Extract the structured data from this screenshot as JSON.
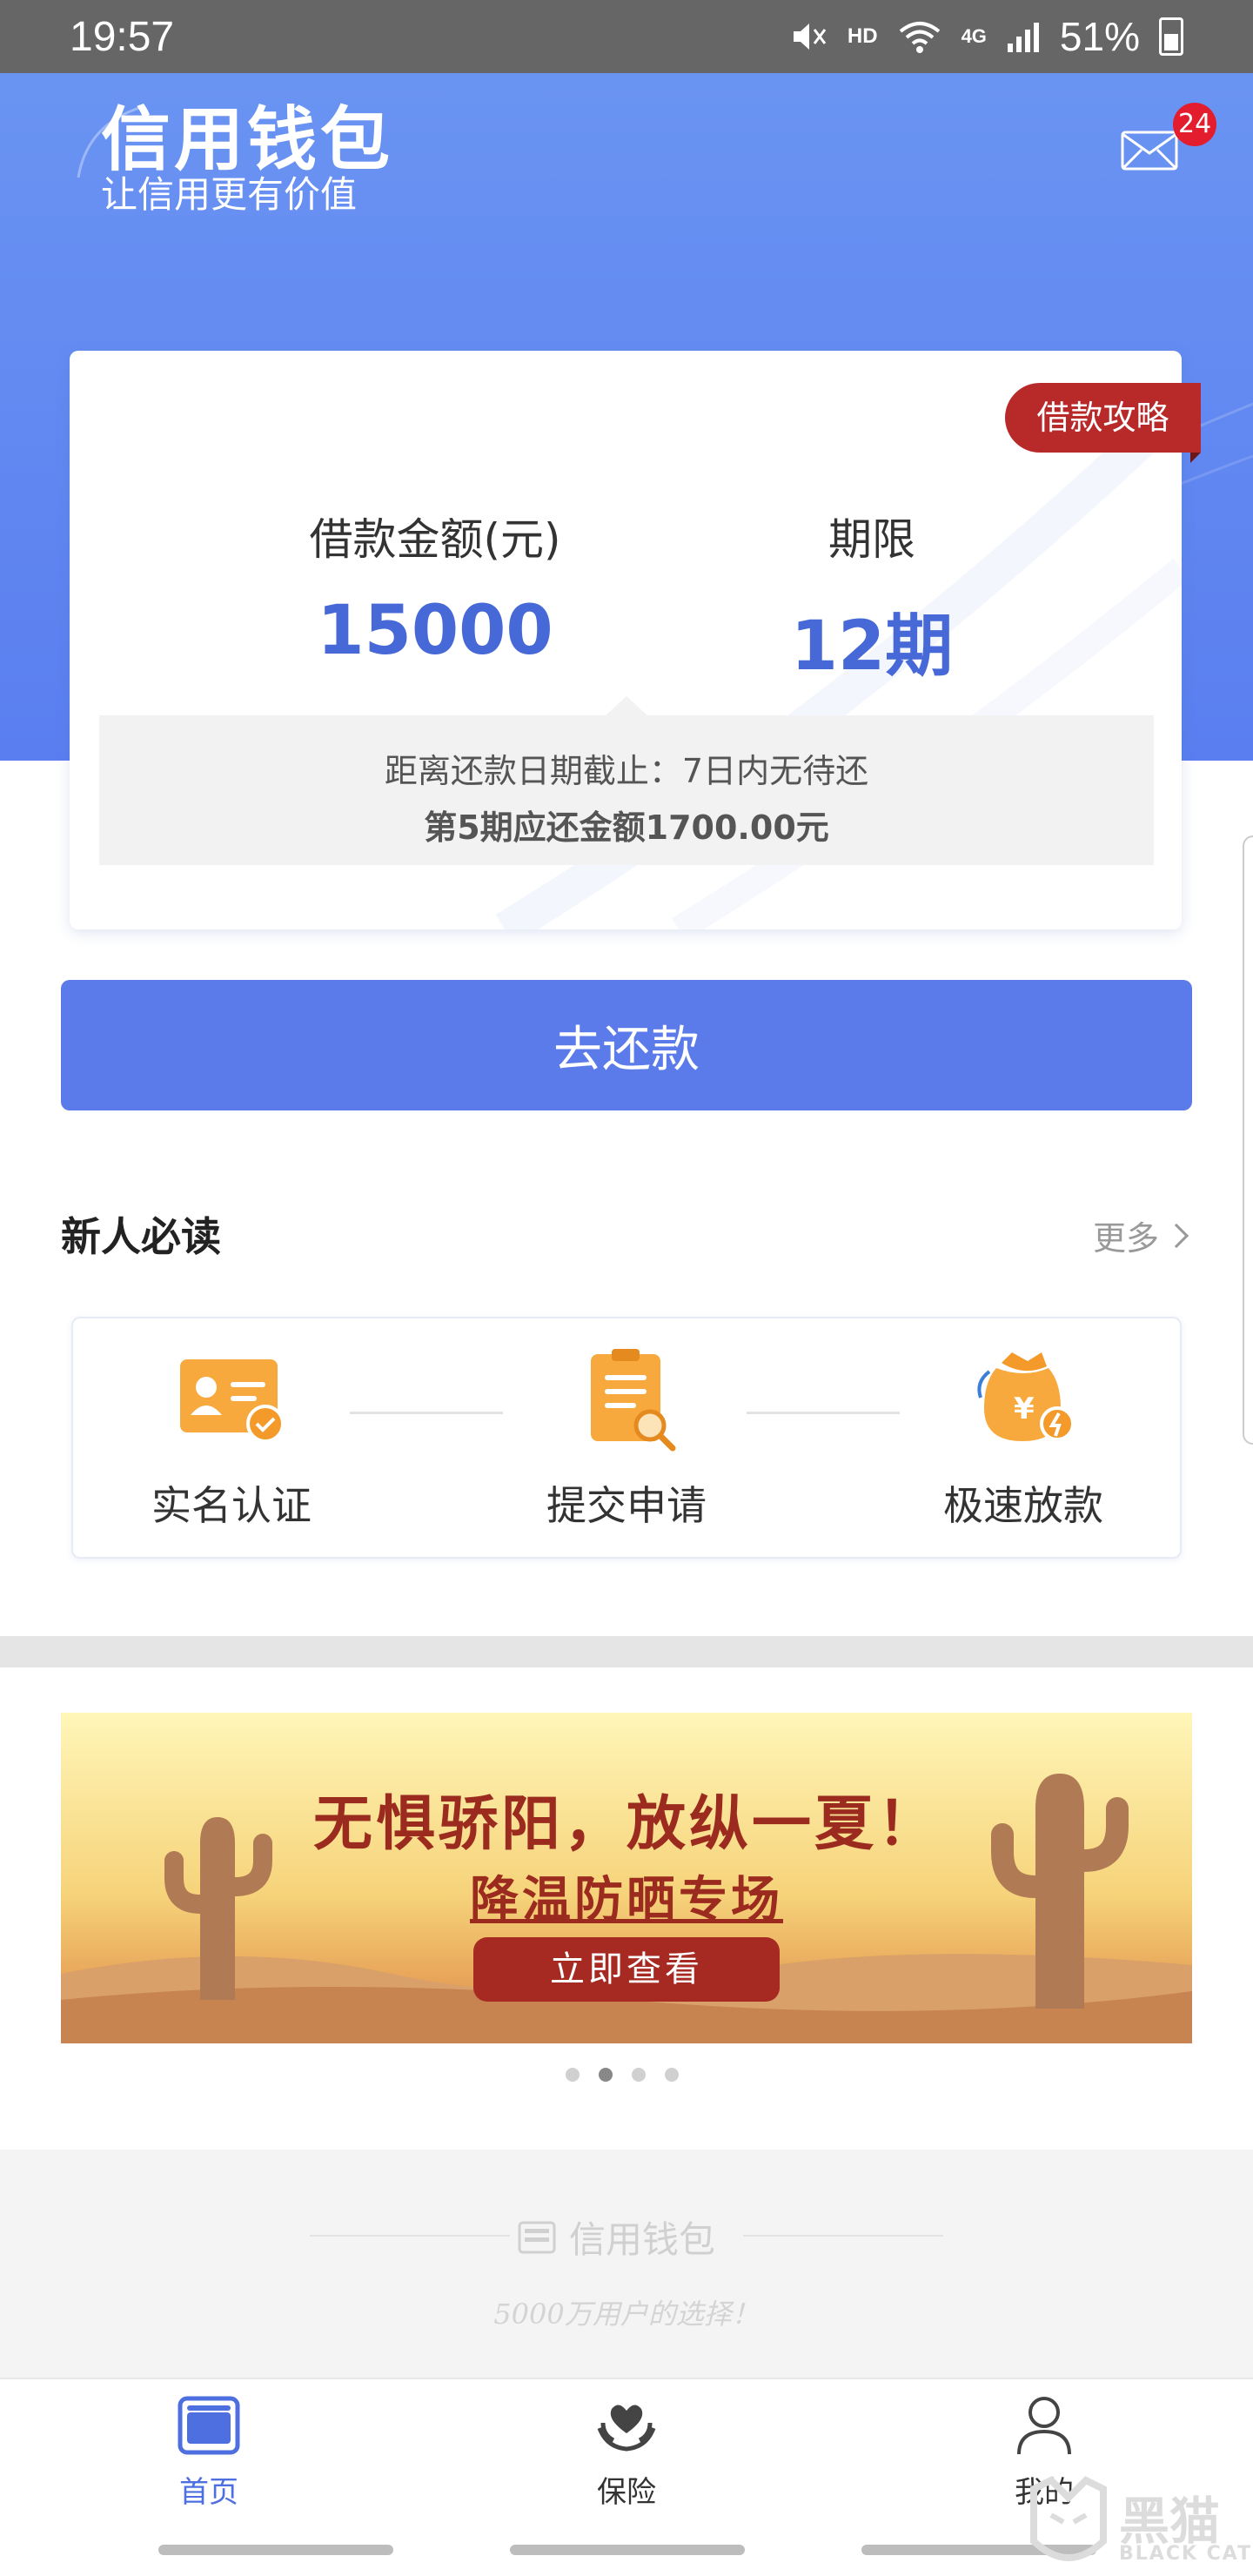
{
  "status_bar": {
    "time": "19:57",
    "network": "HD",
    "signal": "4G",
    "battery": "51%"
  },
  "header": {
    "title": "信用钱包",
    "subtitle": "让信用更有价值",
    "mail_badge": "24"
  },
  "loan_card": {
    "guide_tag": "借款攻略",
    "amount_label": "借款金额(元)",
    "amount_value": "15000",
    "term_label": "期限",
    "term_value": "12期",
    "notice_line1": "距离还款日期截止：7日内无待还",
    "notice_line2": "第5期应还金额1700.00元"
  },
  "repay_button": "去还款",
  "newbie": {
    "title": "新人必读",
    "more": "更多",
    "steps": [
      {
        "label": "实名认证",
        "icon": "id-card-icon"
      },
      {
        "label": "提交申请",
        "icon": "clipboard-icon"
      },
      {
        "label": "极速放款",
        "icon": "money-bag-icon"
      }
    ]
  },
  "banner": {
    "title": "无惧骄阳，放纵一夏！",
    "subtitle": "降温防晒专场",
    "button": "立即查看",
    "slide_count": 4,
    "active_slide": 2
  },
  "footer": {
    "brand": "信用钱包",
    "tagline": "5000万用户的选择！"
  },
  "bottom_nav": [
    {
      "label": "首页",
      "icon": "home-icon",
      "active": true
    },
    {
      "label": "保险",
      "icon": "heart-hands-icon",
      "active": false
    },
    {
      "label": "我的",
      "icon": "user-icon",
      "active": false
    }
  ],
  "watermark": {
    "text": "黑猫",
    "sub": "BLACK CAT"
  },
  "colors": {
    "accent": "#5b7bea",
    "value_blue": "#4769d8",
    "tag_red": "#b82a2a",
    "badge_red": "#e31c2e"
  }
}
